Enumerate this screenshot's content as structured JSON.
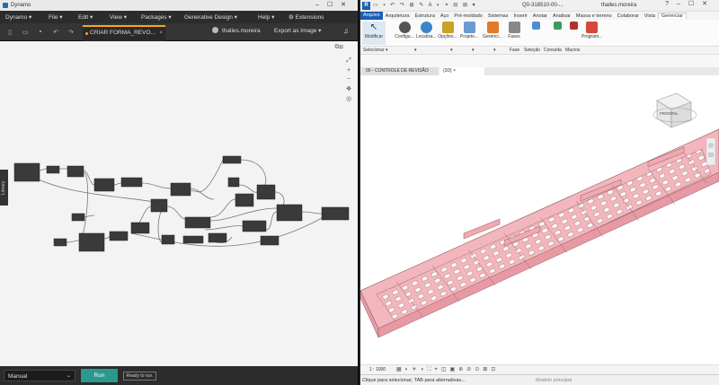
{
  "dynamo": {
    "title": "Dynamo",
    "menu": [
      "Dynamo ▾",
      "File ▾",
      "Edit ▾",
      "View ▾",
      "Packages ▾",
      "Generative Design ▾",
      "Help ▾",
      "⚙ Extensions"
    ],
    "tab_label": "CRIAR FORMA_REVO...",
    "user": "thalles.moreira",
    "export_label": "Export as Image",
    "library_label": "Library",
    "run_mode": "Manual",
    "run_label": "Run",
    "status": "Ready to run."
  },
  "revit": {
    "doc_title": "Q0-318510-00-...",
    "user": "thalles.moreira",
    "tabs": [
      "Arquivo",
      "Arquitetura",
      "Estrutura",
      "Aço",
      "Pré-moldado",
      "Sistemas",
      "Inserir",
      "Anotar",
      "Analisar",
      "Massa e terreno",
      "Colaborar",
      "Vista",
      "Gerenciar"
    ],
    "tools": [
      "Modificar",
      "Configu...",
      "Localiza...",
      "Opções...",
      "Projeto...",
      "Gerenci...",
      "Fases",
      "",
      "",
      "Program..."
    ],
    "panel_labels": [
      "Selecionar ▾",
      "▾",
      "▾",
      "▾",
      "▾",
      "Fase",
      "Seleção",
      "Consulta",
      "Macros"
    ],
    "view_tabs": [
      "00 - CONTROLE DE REVISÃO",
      "{3D}"
    ],
    "viewcube_label": "FRONTAL",
    "scale": "1 : 1000",
    "status_msg": "Clique para selecionar; TAB para alternativas...",
    "model_label": "Modelo principal"
  },
  "colors": {
    "run": "#2a9a8e",
    "accent": "#f5a623",
    "revit_blue": "#1a5fb4",
    "slab": "#f4b6bd"
  }
}
